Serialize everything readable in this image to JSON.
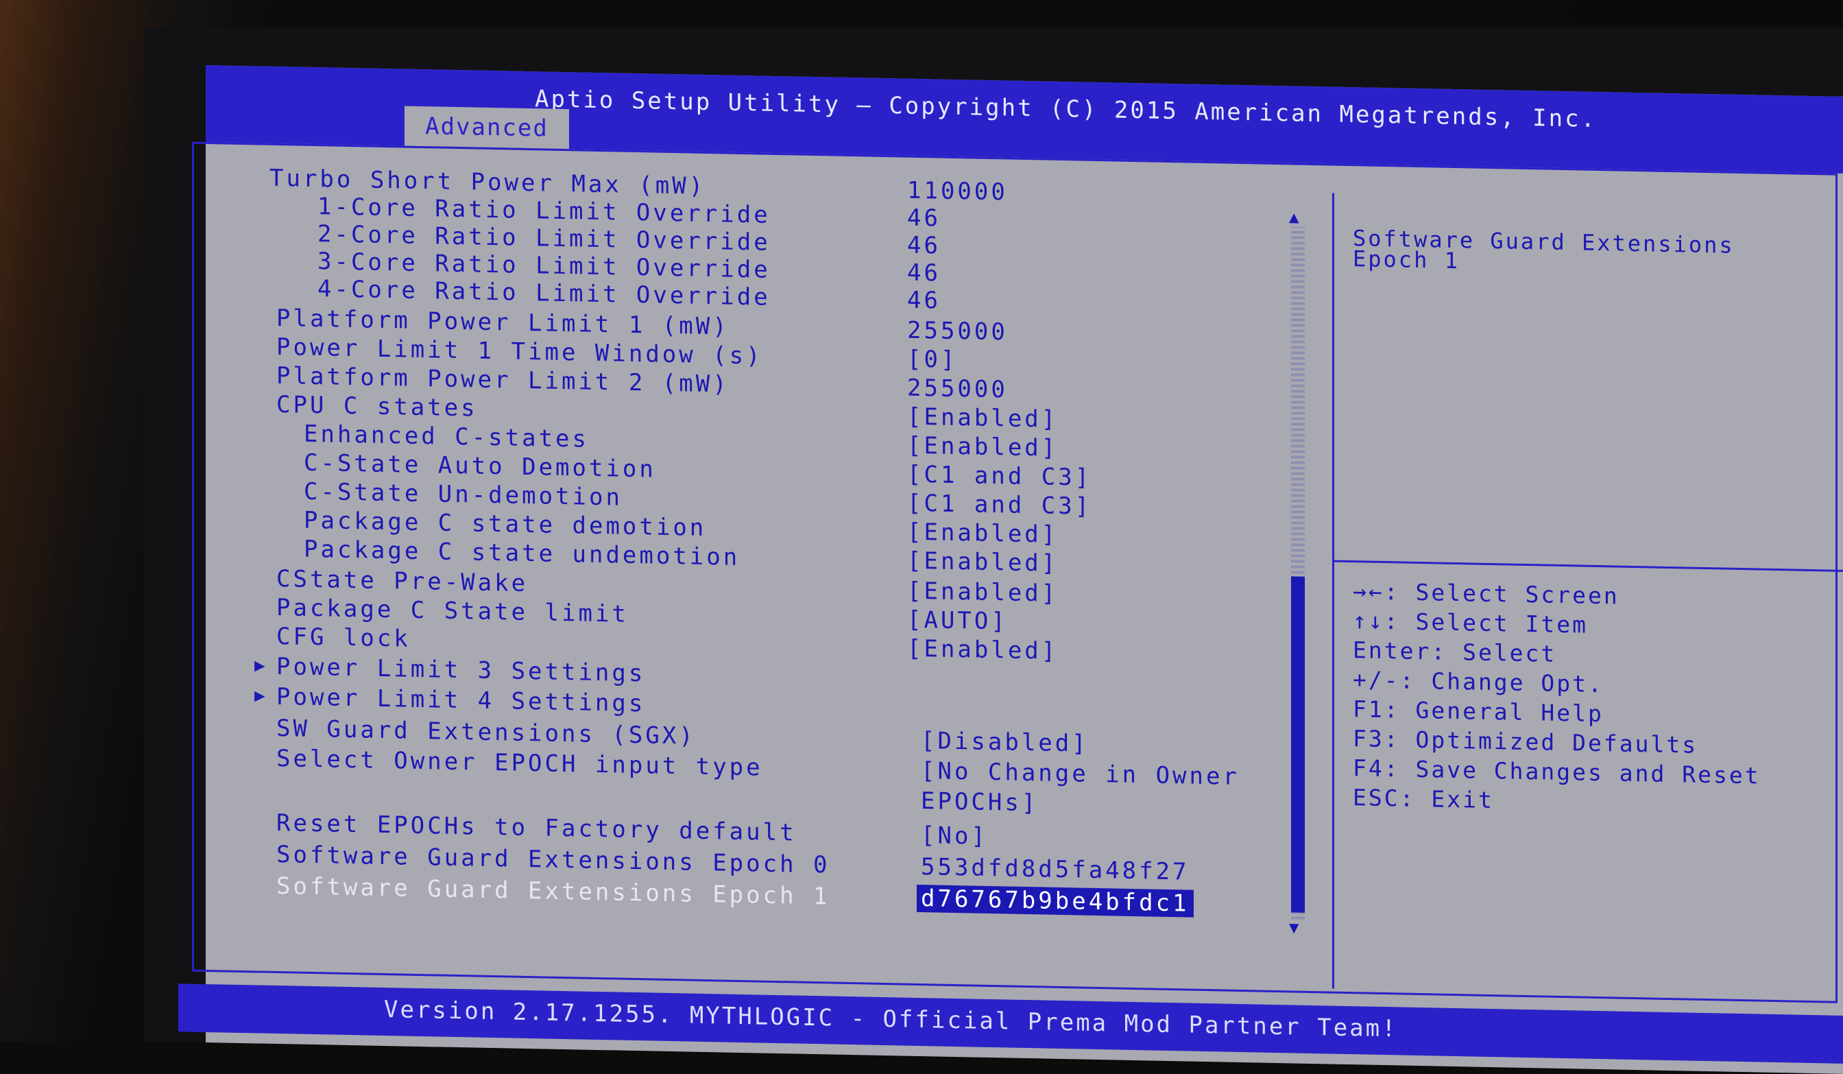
{
  "header": {
    "title": "Aptio Setup Utility – Copyright (C) 2015 American Megatrends, Inc.",
    "active_tab": "Advanced"
  },
  "settings": [
    {
      "label": "Turbo Short Power Max (mW)",
      "value": "110000"
    },
    {
      "label": "1-Core Ratio Limit Override",
      "value": "46"
    },
    {
      "label": "2-Core Ratio Limit Override",
      "value": "46"
    },
    {
      "label": "3-Core Ratio Limit Override",
      "value": "46"
    },
    {
      "label": "4-Core Ratio Limit Override",
      "value": "46"
    },
    {
      "label": "Platform Power Limit 1 (mW)",
      "value": "255000"
    },
    {
      "label": "Power Limit 1 Time Window (s)",
      "value": "[0]"
    },
    {
      "label": "Platform Power Limit 2 (mW)",
      "value": "255000"
    },
    {
      "label": "CPU C states",
      "value": "[Enabled]"
    },
    {
      "label": "Enhanced C-states",
      "value": "[Enabled]"
    },
    {
      "label": "C-State Auto Demotion",
      "value": "[C1 and C3]"
    },
    {
      "label": "C-State Un-demotion",
      "value": "[C1 and C3]"
    },
    {
      "label": "Package C state demotion",
      "value": "[Enabled]"
    },
    {
      "label": "Package C state undemotion",
      "value": "[Enabled]"
    },
    {
      "label": "CState Pre-Wake",
      "value": "[Enabled]"
    },
    {
      "label": "Package C State limit",
      "value": "[AUTO]"
    },
    {
      "label": "CFG lock",
      "value": "[Enabled]"
    },
    {
      "label": "Power Limit 3 Settings",
      "value": ""
    },
    {
      "label": "Power Limit 4 Settings",
      "value": ""
    },
    {
      "label": "SW Guard Extensions (SGX)",
      "value": "[Disabled]"
    },
    {
      "label": "Select Owner EPOCH input type",
      "value": "[No Change in Owner",
      "value_line2": "EPOCHs]"
    },
    {
      "label": "Reset EPOCHs to Factory default",
      "value": "[No]"
    },
    {
      "label": "Software Guard Extensions Epoch 0",
      "value": "553dfd8d5fa48f27"
    },
    {
      "label": "Software Guard Extensions Epoch 1",
      "value": "d76767b9be4bfdc1"
    }
  ],
  "help": {
    "line1": "Software Guard Extensions",
    "line2": "Epoch 1"
  },
  "keys": [
    "→←: Select Screen",
    "↑↓: Select Item",
    "Enter: Select",
    "+/-: Change Opt.",
    "F1: General Help",
    "F3: Optimized Defaults",
    "F4: Save Changes and Reset",
    "ESC: Exit"
  ],
  "footer": {
    "version": "Version 2.17.1255. MYTHLOGIC - Official Prema Mod Partner Team!"
  },
  "icons": {
    "submenu": "right-triangle",
    "scroll_up": "up-triangle",
    "scroll_down": "down-triangle"
  },
  "colors": {
    "bar_blue": "#2a22c8",
    "text_blue": "#1c18b4",
    "background_gray": "#a9a9b2",
    "highlight_text": "#ffffff"
  }
}
